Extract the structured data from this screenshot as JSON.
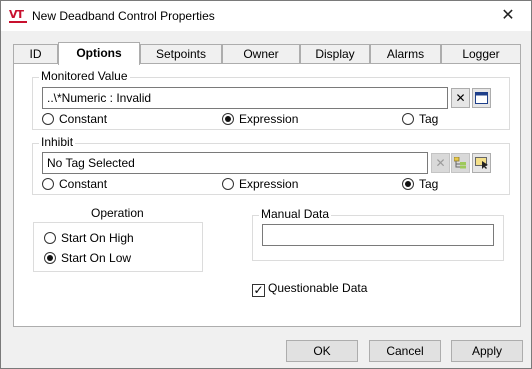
{
  "window": {
    "title": "New Deadband Control Properties",
    "app_icon_text": "VT",
    "brand_color": "#c8102e",
    "close_glyph": "✕"
  },
  "tabs": [
    {
      "label": "ID",
      "active": false
    },
    {
      "label": "Options",
      "active": true
    },
    {
      "label": "Setpoints",
      "active": false
    },
    {
      "label": "Owner",
      "active": false
    },
    {
      "label": "Display",
      "active": false
    },
    {
      "label": "Alarms",
      "active": false
    },
    {
      "label": "Logger",
      "active": false
    }
  ],
  "monitored": {
    "label": "Monitored Value",
    "value": "..\\*Numeric : Invalid",
    "clear_icon": "clear-x-icon",
    "expression_icon": "window-icon",
    "radios": [
      "Constant",
      "Expression",
      "Tag"
    ],
    "selected": "Expression"
  },
  "inhibit": {
    "label": "Inhibit",
    "value": "No Tag Selected",
    "clear_icon": "clear-x-icon",
    "tree_icon": "tag-tree-icon",
    "select_icon": "tag-select-icon",
    "radios": [
      "Constant",
      "Expression",
      "Tag"
    ],
    "selected": "Tag"
  },
  "operation": {
    "label": "Operation",
    "options": [
      "Start On High",
      "Start On Low"
    ],
    "selected": "Start On Low"
  },
  "manual_data": {
    "label": "Manual Data",
    "value": ""
  },
  "questionable": {
    "label": "Questionable Data",
    "checked": true
  },
  "buttons": {
    "ok": "OK",
    "cancel": "Cancel",
    "apply": "Apply"
  }
}
